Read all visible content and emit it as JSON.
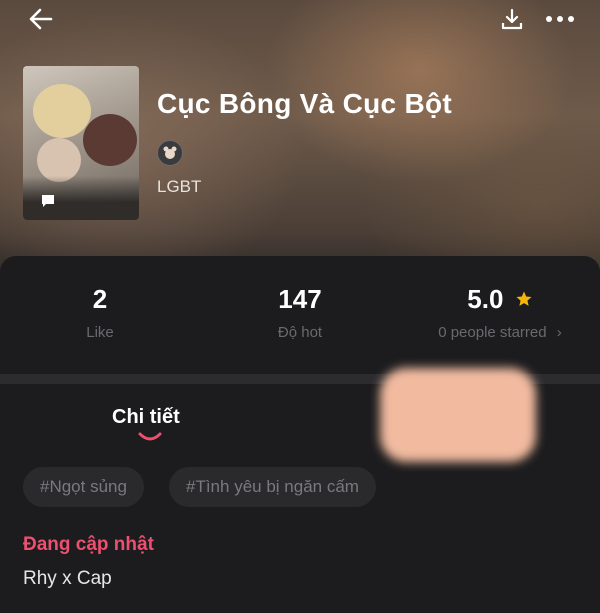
{
  "header": {
    "back_icon": "arrow-left-icon",
    "download_icon": "download-icon",
    "more_icon": "more-dots-icon"
  },
  "story": {
    "title": "Cục Bông Và Cục Bột",
    "genre": "LGBT",
    "cover_badge_icon": "comment-icon",
    "author_avatar_icon": "author-avatar-icon"
  },
  "stats": {
    "likes": {
      "value": "2",
      "label": "Like"
    },
    "hot": {
      "value": "147",
      "label": "Độ hot"
    },
    "rating": {
      "value": "5.0",
      "label": "0 people starred",
      "arrow": "›",
      "star_color": "#f5b50a"
    }
  },
  "tabs": {
    "detail_label": "Chi tiết",
    "underline_color": "#ec4f6f"
  },
  "tags": [
    "#Ngọt sủng",
    "#Tình yêu bị ngăn cấm"
  ],
  "status_text": "Đang cập nhật",
  "status_color": "#ec4f6f",
  "description": "Rhy x Cap"
}
